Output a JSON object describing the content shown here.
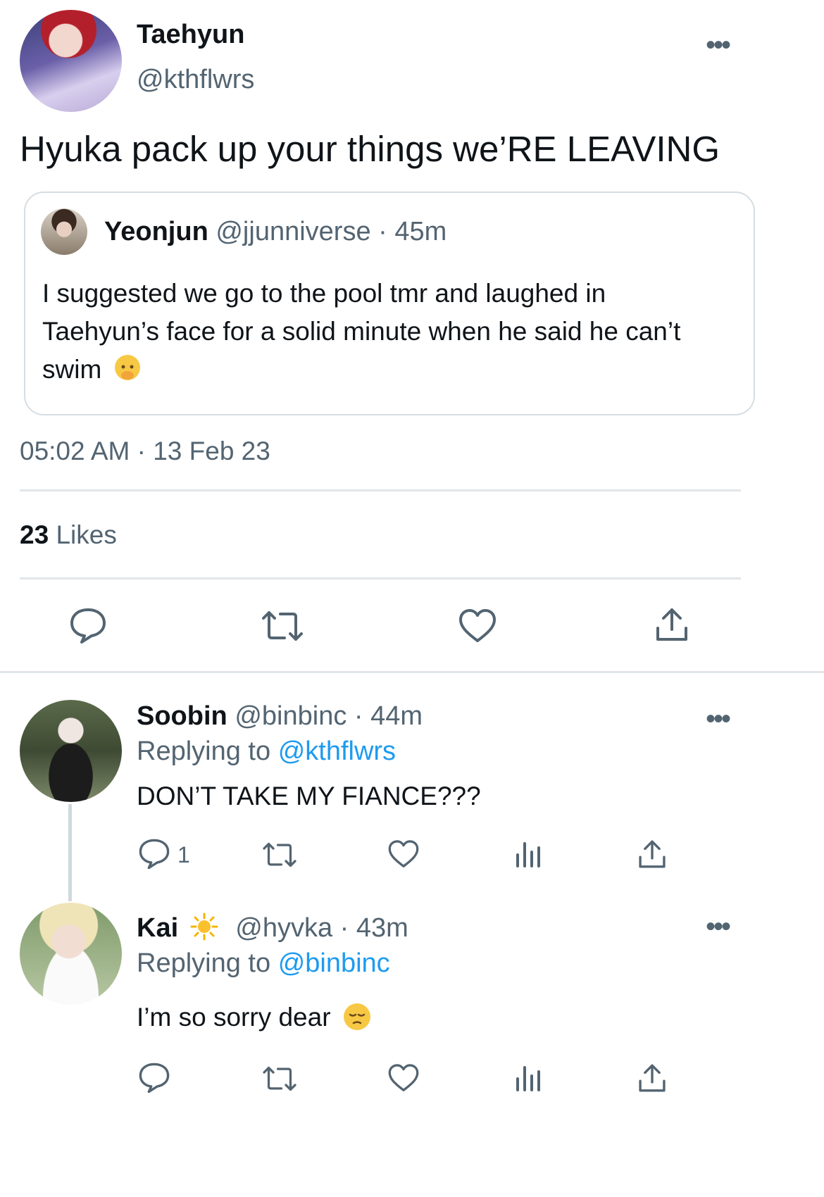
{
  "main_tweet": {
    "author_name": "Taehyun",
    "author_handle": "@kthflwrs",
    "text": "Hyuka pack up your things we’RE LEAVING",
    "timestamp": "05:02 AM · 13 Feb 23",
    "likes_count": "23",
    "likes_label": "Likes"
  },
  "quoted_tweet": {
    "author_name": "Yeonjun",
    "author_handle": "@jjunniverse",
    "time": "· 45m",
    "text": "I suggested we go to the pool tmr and laughed in Taehyun’s face for a solid minute when he said he can’t swim",
    "emoji_icon": "hand-over-mouth-emoji"
  },
  "replies": [
    {
      "author_name": "Soobin",
      "author_handle": "@binbinc",
      "time": "· 44m",
      "replying_to_label": "Replying to",
      "replying_to_handle": "@kthflwrs",
      "text": "DON’T TAKE MY FIANCE???",
      "reply_count": "1"
    },
    {
      "author_name": "Kai",
      "name_emoji_icon": "sun-emoji",
      "author_handle": "@hyvka",
      "time": "· 43m",
      "replying_to_label": "Replying to",
      "replying_to_handle": "@binbinc",
      "text": "I’m so sorry dear",
      "text_emoji_icon": "pensive-face-emoji"
    }
  ],
  "colors": {
    "text": "#0f1419",
    "muted": "#536471",
    "link": "#1d9bf0",
    "divider": "#e1e6ea"
  }
}
